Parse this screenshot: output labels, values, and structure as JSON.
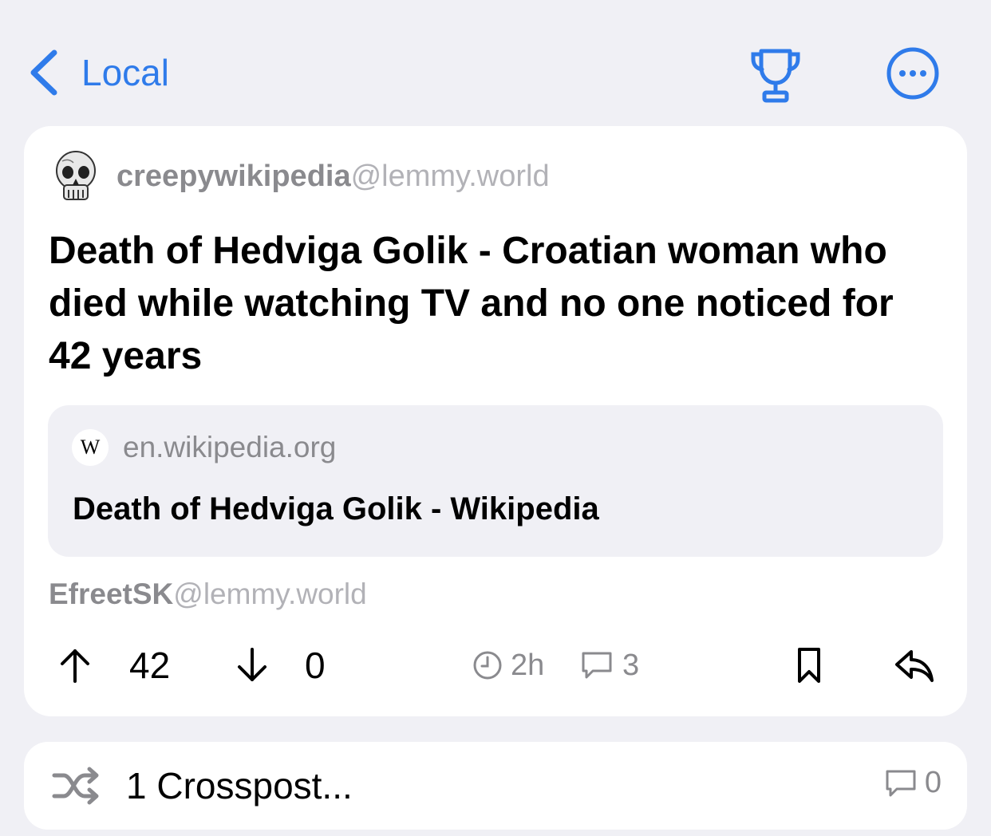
{
  "nav": {
    "back_label": "Local",
    "accent_color": "#2f7bea"
  },
  "post": {
    "community_name": "creepywikipedia",
    "community_instance": "@lemmy.world",
    "title": "Death of Hedviga Golik - Croatian woman who died while watching TV and no one noticed for 42 years",
    "link": {
      "favicon_letter": "W",
      "domain": "en.wikipedia.org",
      "title": "Death of Hedviga Golik - Wikipedia"
    },
    "author_name": "EfreetSK",
    "author_instance": "@lemmy.world",
    "upvotes": "42",
    "downvotes": "0",
    "age": "2h",
    "comment_count": "3"
  },
  "crosspost": {
    "label": "1 Crosspost...",
    "comment_count": "0"
  },
  "icons": [
    "chevron-left-icon",
    "trophy-icon",
    "ellipsis-circle-icon",
    "skull-icon",
    "wikipedia-icon",
    "arrow-up-icon",
    "arrow-down-icon",
    "clock-icon",
    "comment-icon",
    "bookmark-icon",
    "reply-icon",
    "shuffle-icon"
  ]
}
